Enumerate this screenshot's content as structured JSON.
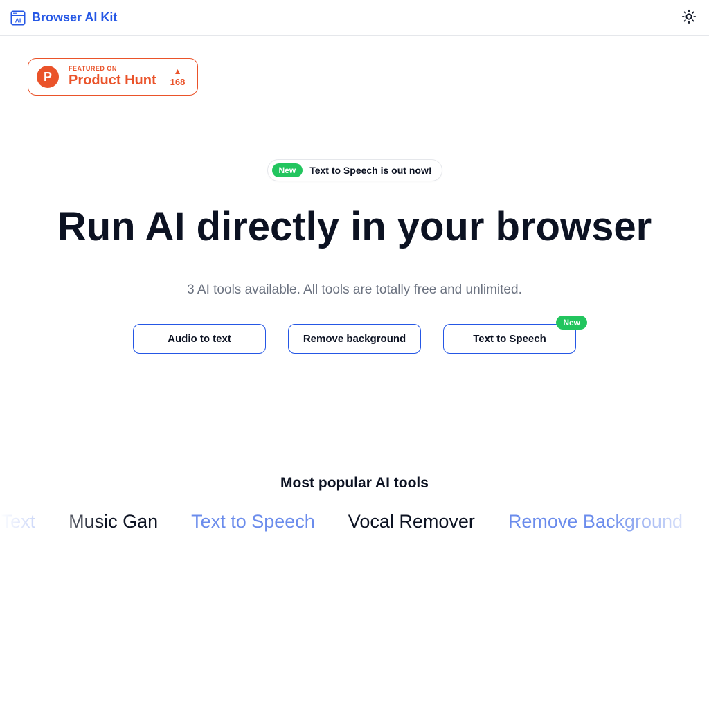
{
  "header": {
    "brand": "Browser AI Kit"
  },
  "productHunt": {
    "featured": "FEATURED ON",
    "name": "Product Hunt",
    "letter": "P",
    "votes": "168"
  },
  "announcement": {
    "badge": "New",
    "text": "Text to Speech is out now!"
  },
  "hero": {
    "title": "Run AI directly in your browser",
    "subtitle": "3 AI tools available. All tools are totally free and unlimited."
  },
  "tools": [
    {
      "label": "Audio to text",
      "badge": null
    },
    {
      "label": "Remove background",
      "badge": null
    },
    {
      "label": "Text to Speech",
      "badge": "New"
    }
  ],
  "popular": {
    "heading": "Most popular AI tools",
    "items": [
      {
        "label": "Audio To Text",
        "link": true
      },
      {
        "label": "Music Gan",
        "link": false
      },
      {
        "label": "Text to Speech",
        "link": true
      },
      {
        "label": "Vocal Remover",
        "link": false
      },
      {
        "label": "Remove Background",
        "link": true
      }
    ]
  }
}
